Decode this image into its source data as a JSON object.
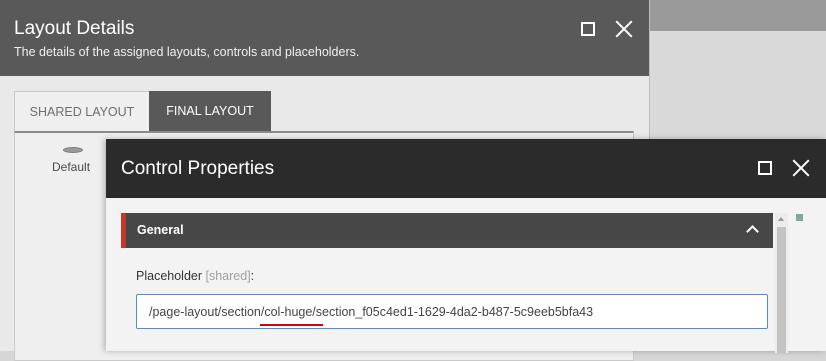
{
  "layout_details": {
    "title": "Layout Details",
    "subtitle": "The details of the assigned layouts, controls and placeholders.",
    "tabs": [
      {
        "label": "SHARED LAYOUT",
        "active": false
      },
      {
        "label": "FINAL LAYOUT",
        "active": true
      }
    ],
    "device_label": "Default"
  },
  "control_properties": {
    "title": "Control Properties",
    "section_title": "General",
    "placeholder_label": "Placeholder",
    "placeholder_shared": "[shared]",
    "placeholder_colon": ":",
    "placeholder_value": "/page-layout/section/col-huge/section_f05c4ed1-1629-4da2-b487-5c9eeb5bfa43"
  },
  "icons": {
    "maximize": "maximize-icon",
    "close": "close-icon",
    "collapse": "chevron-up-icon",
    "device": "device-icon"
  },
  "colors": {
    "header_dark": "#595959",
    "cp_header": "#2b2b2b",
    "section_accent": "#c0392b",
    "input_border": "#4a90d9"
  }
}
